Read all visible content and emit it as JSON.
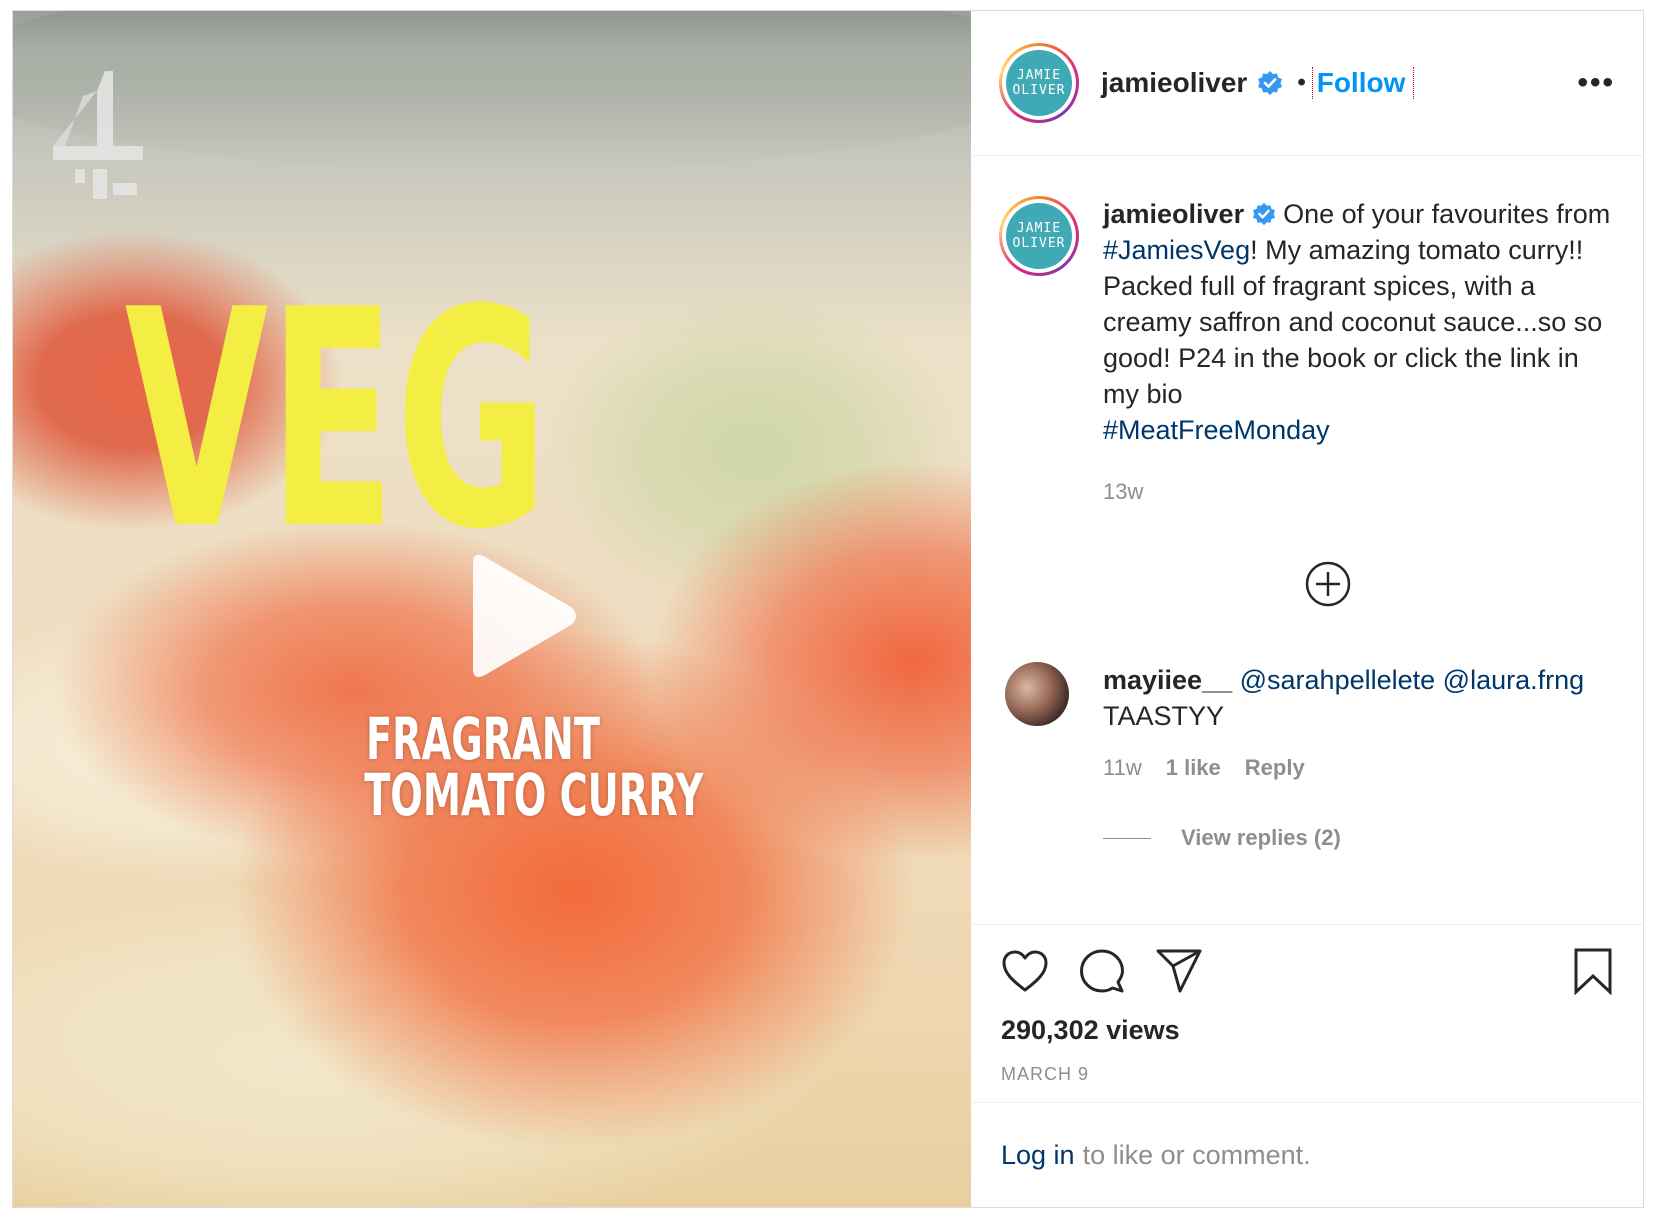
{
  "media": {
    "overlay_title": [
      "V",
      "E",
      "G"
    ],
    "overlay_subtitle": [
      "FRAGRANT",
      "TOMATO CURRY"
    ],
    "title_color": "#f4ee44"
  },
  "header": {
    "avatar_text": [
      "JAMIE",
      "OLIVER"
    ],
    "username": "jamieoliver",
    "separator": "•",
    "follow_label": "Follow",
    "more_label": "•••"
  },
  "caption": {
    "username": "jamieoliver",
    "text_before_tag": " One of your favourites from ",
    "hashtag1": "#JamiesVeg",
    "text_after_tag": "! My amazing tomato curry!! Packed full of fragrant spices, with a creamy saffron and coconut sauce...so so good! P24 in the book or click the link in my bio",
    "hashtag2": "#MeatFreeMonday",
    "time": "13w"
  },
  "comment": {
    "username": "mayiiee__",
    "mention1": "@sarahpellelete",
    "mention2": "@laura.frng",
    "text": "TAASTYY",
    "time": "11w",
    "likes": "1 like",
    "reply_label": "Reply",
    "view_replies": "View replies (2)"
  },
  "actions": {
    "views": "290,302 views",
    "date": "MARCH 9"
  },
  "login": {
    "link": "Log in",
    "rest": "to like or comment."
  },
  "colors": {
    "link_blue": "#0095f6",
    "hashtag": "#00376b",
    "muted": "#8e8e8e"
  }
}
